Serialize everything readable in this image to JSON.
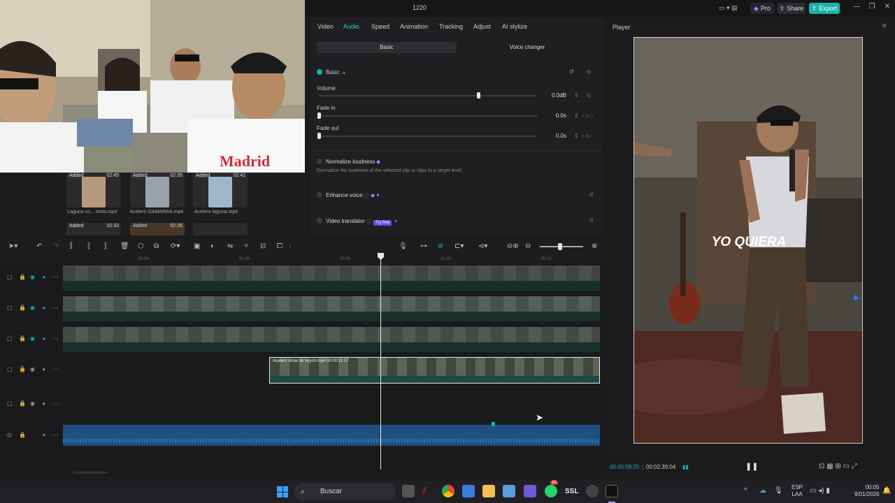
{
  "window": {
    "title": "1220"
  },
  "header": {
    "pro_label": "Pro",
    "share_label": "Share",
    "export_label": "Export"
  },
  "webcam": {
    "shirt_text": "Madrid"
  },
  "media": {
    "items": [
      {
        "added": "Added",
        "duration": "02:45",
        "name": "Laguna co... moto.mp4"
      },
      {
        "added": "Added",
        "duration": "02:35",
        "name": "Acelero GAMARRA.mp4"
      },
      {
        "added": "Added",
        "duration": "02:42",
        "name": "Acelero laguna.mp4"
      }
    ],
    "row2": [
      {
        "added": "Added",
        "duration": "02:33"
      },
      {
        "added": "Added",
        "duration": "02:26"
      }
    ]
  },
  "inspector": {
    "tabs": [
      "Video",
      "Audio",
      "Speed",
      "Animation",
      "Tracking",
      "Adjust",
      "AI stylize"
    ],
    "active_tab": "Audio",
    "subtabs": {
      "basic": "Basic",
      "voice": "Voice changer"
    },
    "section": "Basic",
    "volume": {
      "label": "Volume",
      "value": "0.0dB",
      "level": 0.73
    },
    "fade_in": {
      "label": "Fade in",
      "value": "0.0s"
    },
    "fade_out": {
      "label": "Fade out",
      "value": "0.0s"
    },
    "normalize": {
      "label": "Normalize loudness",
      "desc": "Normalize the loudness of the selected clip or clips to a target level."
    },
    "enhance": {
      "label": "Enhance voice"
    },
    "translator": {
      "label": "Video translator",
      "badge": "Try free"
    }
  },
  "timeline": {
    "ruler": [
      "00:04",
      "00:06",
      "00:08",
      "00:10",
      "00:12"
    ],
    "clip_label": "Acelero show de veyoh.mp4   00:00:11:17",
    "colors": {
      "accent": "#19b3a6",
      "audio": "#1f5f9a",
      "clip_border": "#e8e8e8"
    }
  },
  "player": {
    "label": "Player",
    "caption": "YO QUIERA",
    "current_time": "00:00:08:25",
    "total_time": "00:02:39:04"
  },
  "taskbar": {
    "search": "Buscar",
    "ssl": "SSL",
    "badge": "99",
    "lang1": "ESP",
    "lang2": "LAA",
    "time": "00:05",
    "date": "9/01/2026"
  }
}
